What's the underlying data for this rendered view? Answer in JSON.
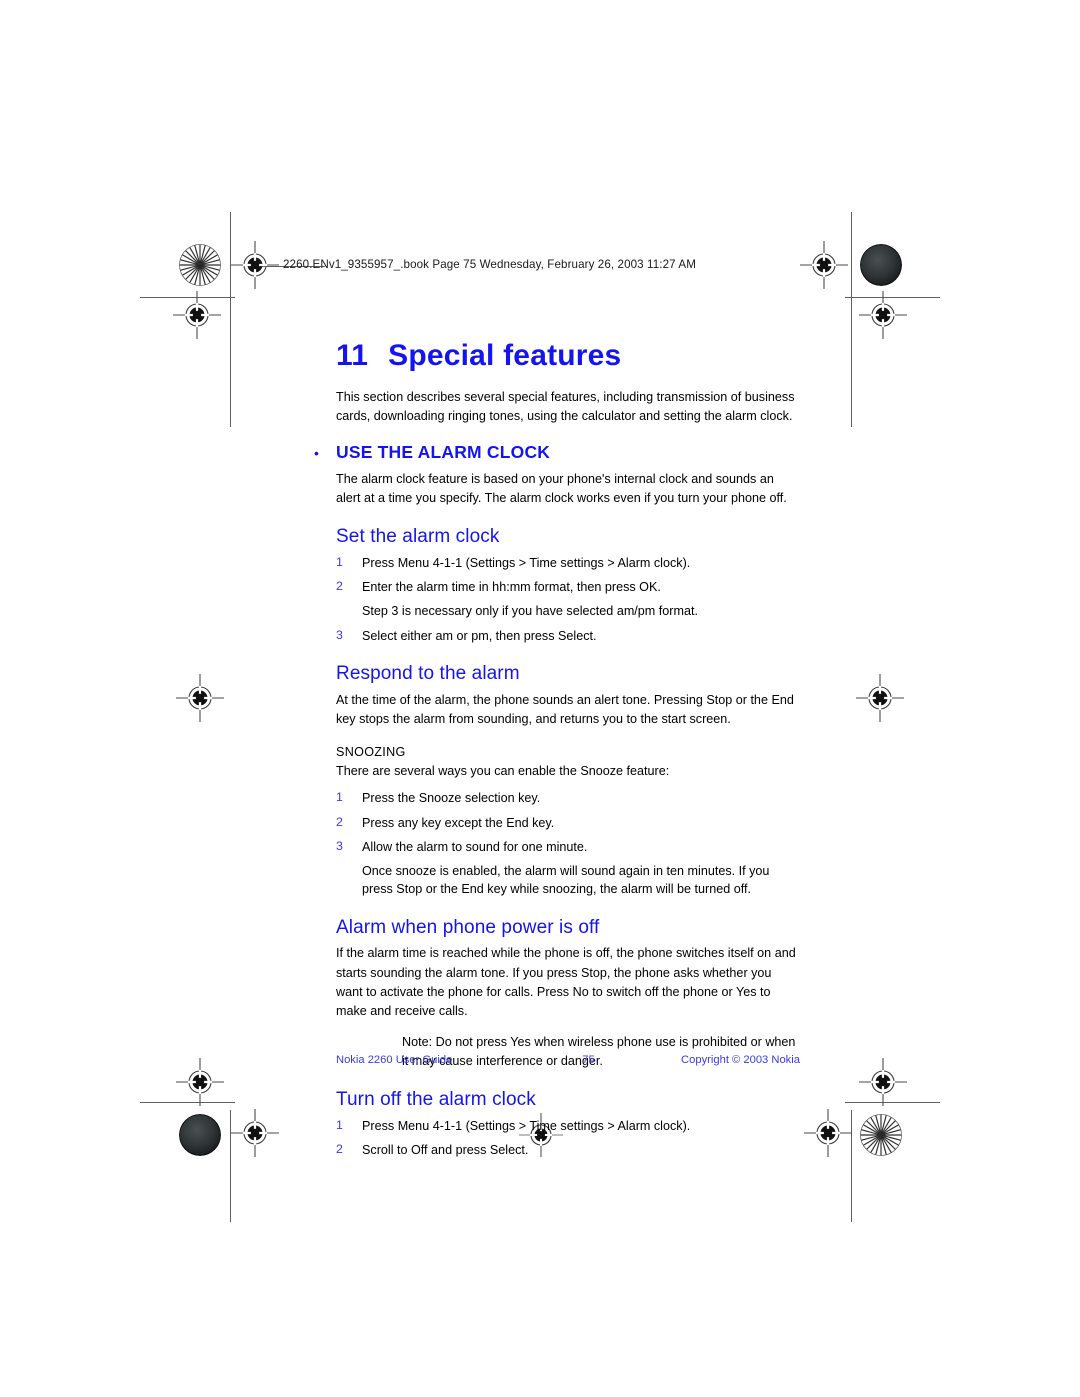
{
  "document": {
    "slug": "2260.ENv1_9355957_.book  Page 75  Wednesday, February 26, 2003  11:27 AM",
    "chapter_number": "11",
    "chapter_title": "Special features",
    "intro": "This section describes several special features, including transmission of business cards, downloading ringing tones, using the calculator and setting the alarm clock."
  },
  "colors": {
    "heading_blue": "#1414f0",
    "list_marker_blue": "#3a3ae6",
    "body_black": "#000000",
    "footer_blue": "#3a3ae6",
    "mark_gray": "#5f5f5f"
  },
  "sections": {
    "use_alarm_clock": {
      "bullet": "•",
      "title": "USE THE ALARM CLOCK",
      "body": "The alarm clock feature is based on your phone's internal clock and sounds an alert at a time you specify. The alarm clock works even if you turn your phone off."
    },
    "set_alarm_clock": {
      "title": "Set the alarm clock",
      "steps": [
        {
          "marker": "1",
          "text": "Press Menu 4-1-1 (Settings > Time settings > Alarm clock)."
        },
        {
          "marker": "2",
          "text": "Enter the alarm time in hh:mm format, then press OK."
        }
      ],
      "step_note": "Step 3 is necessary only if you have selected am/pm format.",
      "steps_after": [
        {
          "marker": "3",
          "text": "Select either am or pm, then press Select."
        }
      ]
    },
    "respond_to_alarm": {
      "title": "Respond to the alarm",
      "body": "At the time of the alarm, the phone sounds an alert tone. Pressing Stop or the End key stops the alarm from sounding, and returns you to the start screen.",
      "snoozing_heading": "SNOOZING",
      "snoozing_intro": "There are several ways you can enable the Snooze feature:",
      "steps": [
        {
          "marker": "1",
          "text": "Press the Snooze selection key."
        },
        {
          "marker": "2",
          "text": "Press any key except the End key."
        },
        {
          "marker": "3",
          "text": "Allow the alarm to sound for one minute."
        }
      ],
      "step_note": "Once snooze is enabled, the alarm will sound again in ten minutes. If you press Stop or the End key while snoozing, the alarm will be turned off."
    },
    "alarm_power_off": {
      "title": "Alarm when phone power is off",
      "body": "If the alarm time is reached while the phone is off, the phone switches itself on and starts sounding the alarm tone. If you press Stop, the phone asks whether you want to activate the phone for calls. Press No to switch off the phone or Yes to make and receive calls.",
      "note": "Note: Do not press Yes when wireless phone use is prohibited or when it may cause interference or danger."
    },
    "turn_off_alarm": {
      "title": "Turn off the alarm clock",
      "steps": [
        {
          "marker": "1",
          "text": "Press Menu 4-1-1 (Settings > Time settings > Alarm clock)."
        },
        {
          "marker": "2",
          "text": "Scroll to Off and press Select."
        }
      ]
    }
  },
  "footer": {
    "left": "Nokia 2260 User Guide",
    "page_number": "75",
    "right": "Copyright © 2003 Nokia"
  }
}
